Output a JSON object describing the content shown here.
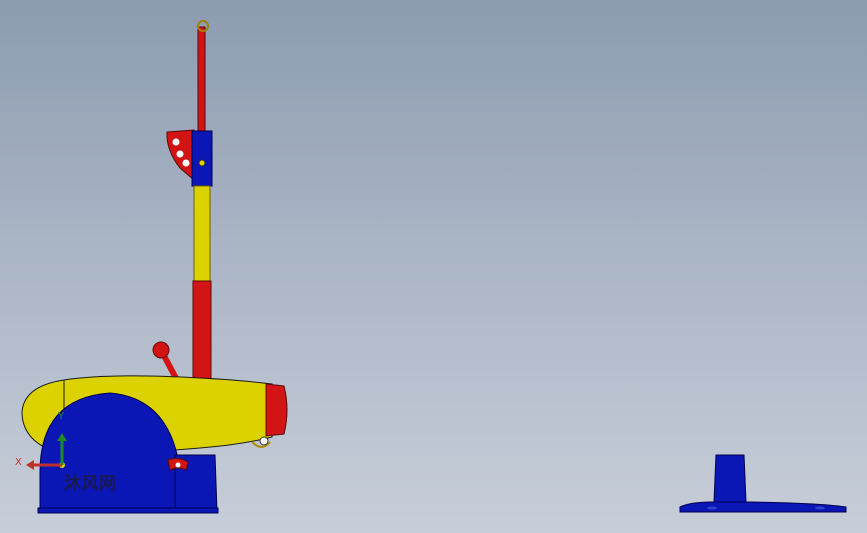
{
  "viewport": {
    "background_top": "#8c9bb0",
    "background_bottom": "#c7ced9"
  },
  "model": {
    "part_colors": {
      "body": "#dcd200",
      "base": "#0a17b4",
      "accent": "#d21414",
      "outline": "#1a1a1a"
    },
    "parts": [
      "cannon-barrel",
      "barrel-muzzle",
      "carriage-arch",
      "vertical-pole",
      "crank-handle",
      "pole-bracket",
      "separate-base-part"
    ]
  },
  "triad": {
    "x_label": "X",
    "y_label": "Y",
    "x_color": "#c0302a",
    "y_color": "#1e8a2a"
  },
  "watermark": {
    "text": "沐风网"
  }
}
